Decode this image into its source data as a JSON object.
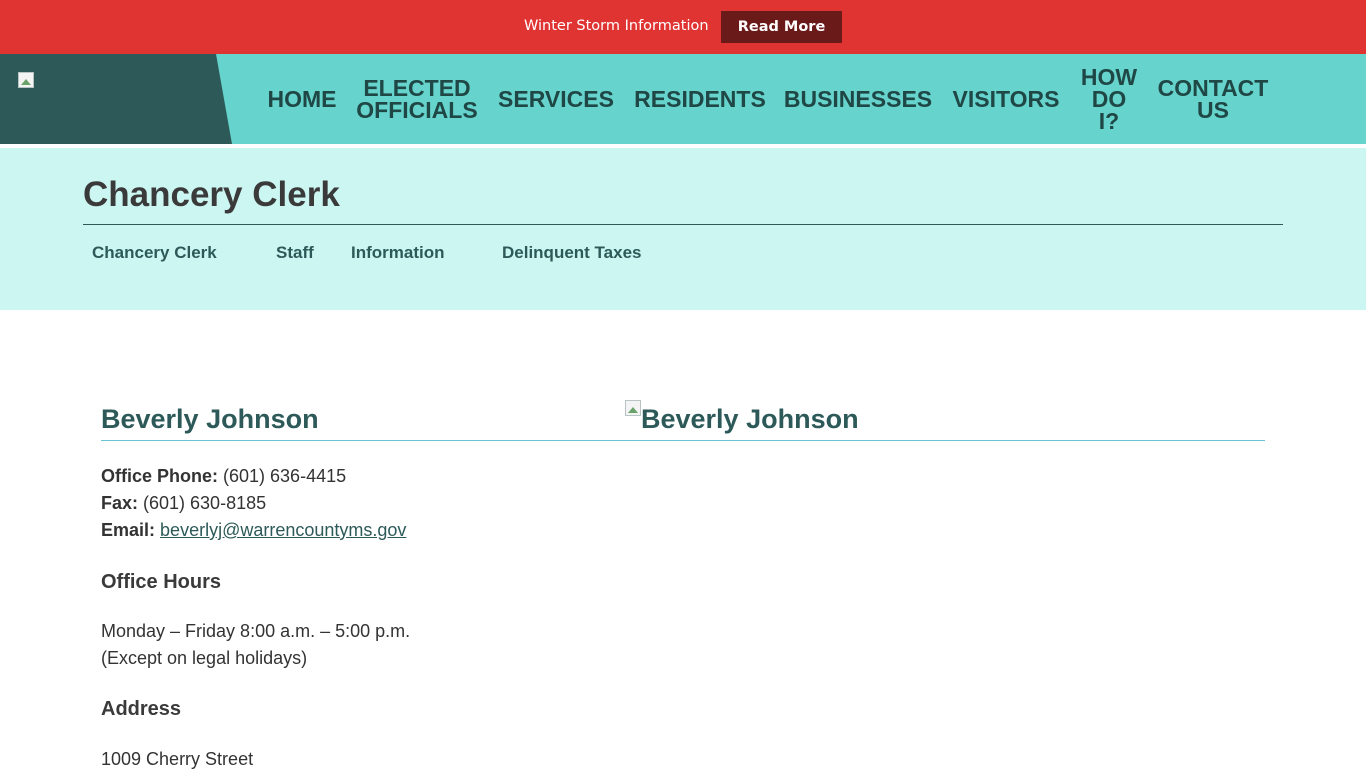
{
  "alert": {
    "text": "Winter Storm Information",
    "button_label": "Read More"
  },
  "header": {
    "nav": [
      {
        "line1": "HOME",
        "line2": "",
        "line3": ""
      },
      {
        "line1": "ELECTED",
        "line2": "OFFICIALS",
        "line3": ""
      },
      {
        "line1": "SERVICES",
        "line2": "",
        "line3": ""
      },
      {
        "line1": "RESIDENTS",
        "line2": "",
        "line3": ""
      },
      {
        "line1": "BUSINESSES",
        "line2": "",
        "line3": ""
      },
      {
        "line1": "VISITORS",
        "line2": "",
        "line3": ""
      },
      {
        "line1": "HOW",
        "line2": "DO",
        "line3": "I?"
      },
      {
        "line1": "CONTACT",
        "line2": "US",
        "line3": ""
      }
    ]
  },
  "page": {
    "title": "Chancery Clerk",
    "subnav": [
      "Chancery Clerk",
      "Staff",
      "Information",
      "Delinquent Taxes"
    ]
  },
  "profile": {
    "name": "Beverly Johnson",
    "photo_alt": "Beverly Johnson",
    "phone_label": "Office Phone:",
    "phone": " (601) 636-4415",
    "fax_label": "Fax:",
    "fax": " (601) 630-8185",
    "email_label": "Email:",
    "email": "beverlyj@warrencountyms.gov",
    "hours_heading": "Office Hours",
    "hours_line1": "Monday – Friday 8:00 a.m. – 5:00 p.m.",
    "hours_line2": "(Except on legal holidays)",
    "address_heading": "Address",
    "address_line1": "1009 Cherry Street"
  },
  "colors": {
    "alert_red": "#e03433",
    "alert_button": "#6b1a1a",
    "header_teal": "#66d3cc",
    "logo_dark_teal": "#2d5a59",
    "subheader_bg": "#ccf6f2",
    "link_teal": "#2d5a59"
  }
}
